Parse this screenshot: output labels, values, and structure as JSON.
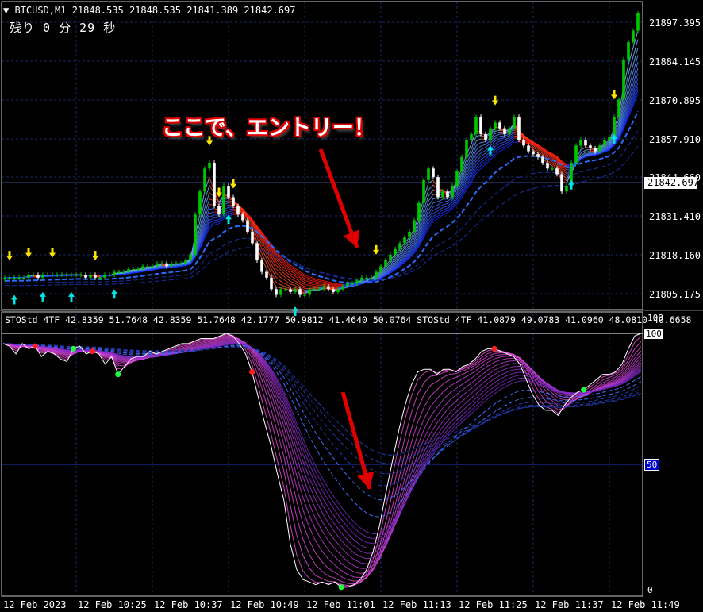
{
  "header": {
    "symbol_line": "▼ BTCUSD,M1  21848.535 21848.535 21841.389 21842.697",
    "timer_line": "残り 0 分 29 秒"
  },
  "annotation": {
    "text": "ここで、エントリー！"
  },
  "price_axis": {
    "ticks": [
      "21897.395",
      "21884.145",
      "21870.895",
      "21857.910",
      "21844.660",
      "21831.410",
      "21818.160",
      "21805.175"
    ],
    "current_price": "21842.697"
  },
  "indicator": {
    "label": "STOStd_4TF 42.8359 51.7648 42.8359 51.7648 42.1777 50.9812 41.4640 50.0764  STOStd_4TF 41.0879 49.0783 41.0960 48.0810 40.6658",
    "top_label": "108",
    "hundred_label": "100",
    "fifty_label": "50",
    "zero_label": "0"
  },
  "time_axis": {
    "ticks": [
      "12 Feb 2023",
      "12 Feb 10:25",
      "12 Feb 10:37",
      "12 Feb 10:49",
      "12 Feb 11:01",
      "12 Feb 11:13",
      "12 Feb 11:25",
      "12 Feb 11:37",
      "12 Feb 11:49"
    ]
  },
  "colors": {
    "background": "#000000",
    "bull_candle": "#00c800",
    "bear_candle": "#ffffff",
    "grid": "#1a2a66",
    "arrow_annotation": "#e00000",
    "signal_up": "#00e5e5",
    "signal_down": "#ffe600"
  },
  "chart_data": [
    {
      "type": "line",
      "title": "BTCUSD,M1",
      "ylim": [
        21800,
        21905
      ],
      "series": [
        {
          "values": [
            21810,
            21810,
            21810,
            21810,
            21810,
            21811,
            21811,
            21810,
            21811,
            21811,
            21811,
            21811,
            21811,
            21811,
            21811,
            21811,
            21811,
            21810,
            21811,
            21810,
            21810,
            21811,
            21811,
            21812,
            21812,
            21812,
            21813,
            21813,
            21813,
            21814,
            21814,
            21814,
            21815,
            21815,
            21814,
            21815,
            21815,
            21815,
            21816,
            21818,
            21832,
            21840,
            21848,
            21850,
            21835,
            21832,
            21842,
            21838,
            21835,
            21832,
            21830,
            21826,
            21822,
            21816,
            21812,
            21810,
            21806,
            21804,
            21806,
            21806,
            21805,
            21806,
            21804,
            21804,
            21806,
            21806,
            21806,
            21807,
            21806,
            21805,
            21806,
            21807,
            21808,
            21808,
            21809,
            21810,
            21810,
            21810,
            21812,
            21814,
            21816,
            21818,
            21820,
            21822,
            21824,
            21826,
            21830,
            21836,
            21844,
            21848,
            21845,
            21838,
            21840,
            21838,
            21842,
            21847,
            21852,
            21858,
            21860,
            21866,
            21860,
            21858,
            21862,
            21864,
            21862,
            21860,
            21862,
            21866,
            21858,
            21856,
            21854,
            21853,
            21852,
            21850,
            21848,
            21848,
            21846,
            21840,
            21842,
            21850,
            21856,
            21858,
            21856,
            21855,
            21854,
            21856,
            21858,
            21859,
            21866,
            21872,
            21886,
            21892,
            21896,
            21902
          ]
        }
      ]
    },
    {
      "type": "line",
      "title": "STOStd_4TF",
      "ylim": [
        0,
        108
      ],
      "series": [
        {
          "values": [
            96,
            95,
            92,
            96,
            94,
            95,
            91,
            93,
            92,
            90,
            89,
            94,
            95,
            92,
            93,
            92,
            88,
            91,
            84,
            87,
            90,
            91,
            91,
            93,
            92,
            93,
            94,
            95,
            96,
            96,
            97,
            98,
            98,
            98,
            99,
            100,
            99,
            96,
            92,
            85,
            75,
            65,
            56,
            45,
            35,
            18,
            8,
            4,
            3,
            2,
            3,
            2,
            3,
            1,
            1,
            2,
            4,
            8,
            15,
            25,
            38,
            50,
            62,
            72,
            80,
            85,
            86,
            86,
            84,
            86,
            86,
            85,
            87,
            88,
            90,
            93,
            94,
            94,
            93,
            92,
            91,
            88,
            82,
            76,
            72,
            70,
            70,
            68,
            72,
            75,
            77,
            78,
            80,
            82,
            84,
            84,
            85,
            88,
            94,
            99,
            100
          ]
        }
      ]
    }
  ]
}
